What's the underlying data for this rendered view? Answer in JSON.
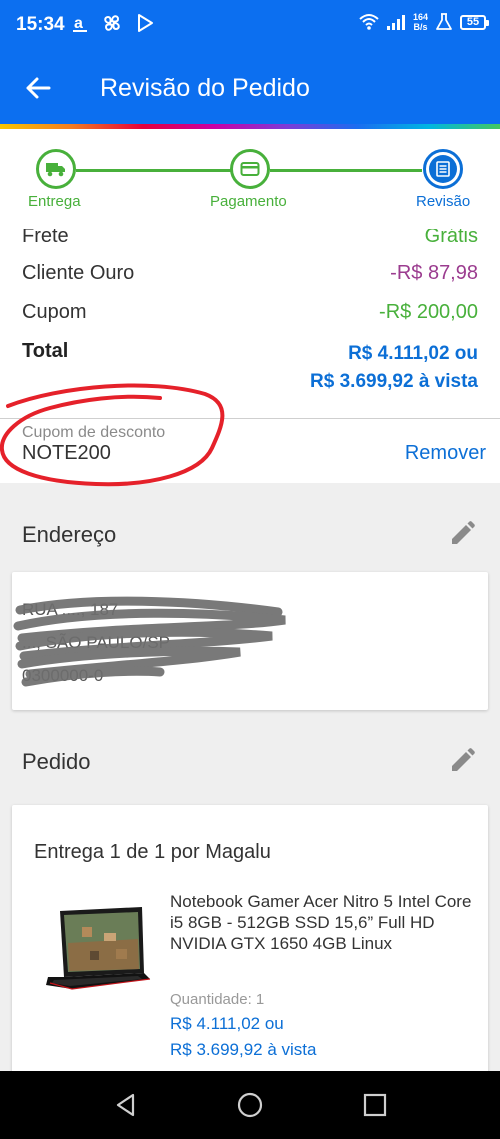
{
  "status_bar": {
    "time": "15:34",
    "net_speed_top": "164",
    "net_speed_unit": "B/s",
    "battery": "55"
  },
  "header": {
    "title": "Revisão do Pedido"
  },
  "steps": [
    {
      "label": "Entrega"
    },
    {
      "label": "Pagamento"
    },
    {
      "label": "Revisão"
    }
  ],
  "summary": {
    "frete": {
      "label": "Frete",
      "value": "Grátis"
    },
    "cliente_ouro": {
      "label": "Cliente Ouro",
      "value": "-R$ 87,98"
    },
    "cupom": {
      "label": "Cupom",
      "value": "-R$ 200,00"
    },
    "total": {
      "label": "Total",
      "value_installment": "R$ 4.111,02 ou",
      "value_cash": "R$ 3.699,92 à vista"
    }
  },
  "coupon": {
    "label": "Cupom de desconto",
    "code": "NOTE200",
    "remove_label": "Remover"
  },
  "address": {
    "section_title": "Endereço",
    "line1": "RUA ...., 187",
    "line2": "..., SÃO PAULO/SP",
    "line3": "0300000-0"
  },
  "order": {
    "section_title": "Pedido",
    "delivery_title": "Entrega 1 de 1 por Magalu",
    "product_name": "Notebook Gamer Acer Nitro 5 Intel Core i5 8GB - 512GB SSD 15,6” Full HD NVIDIA GTX 1650 4GB Linux",
    "quantity_label": "Quantidade:",
    "quantity": "1",
    "price_installment": "R$ 4.111,02 ou",
    "price_cash": "R$ 3.699,92 à vista"
  },
  "colors": {
    "primary": "#0c6ff0",
    "success": "#48b03b",
    "gold_discount": "#9b3c8f",
    "link": "#0c6fd6"
  }
}
